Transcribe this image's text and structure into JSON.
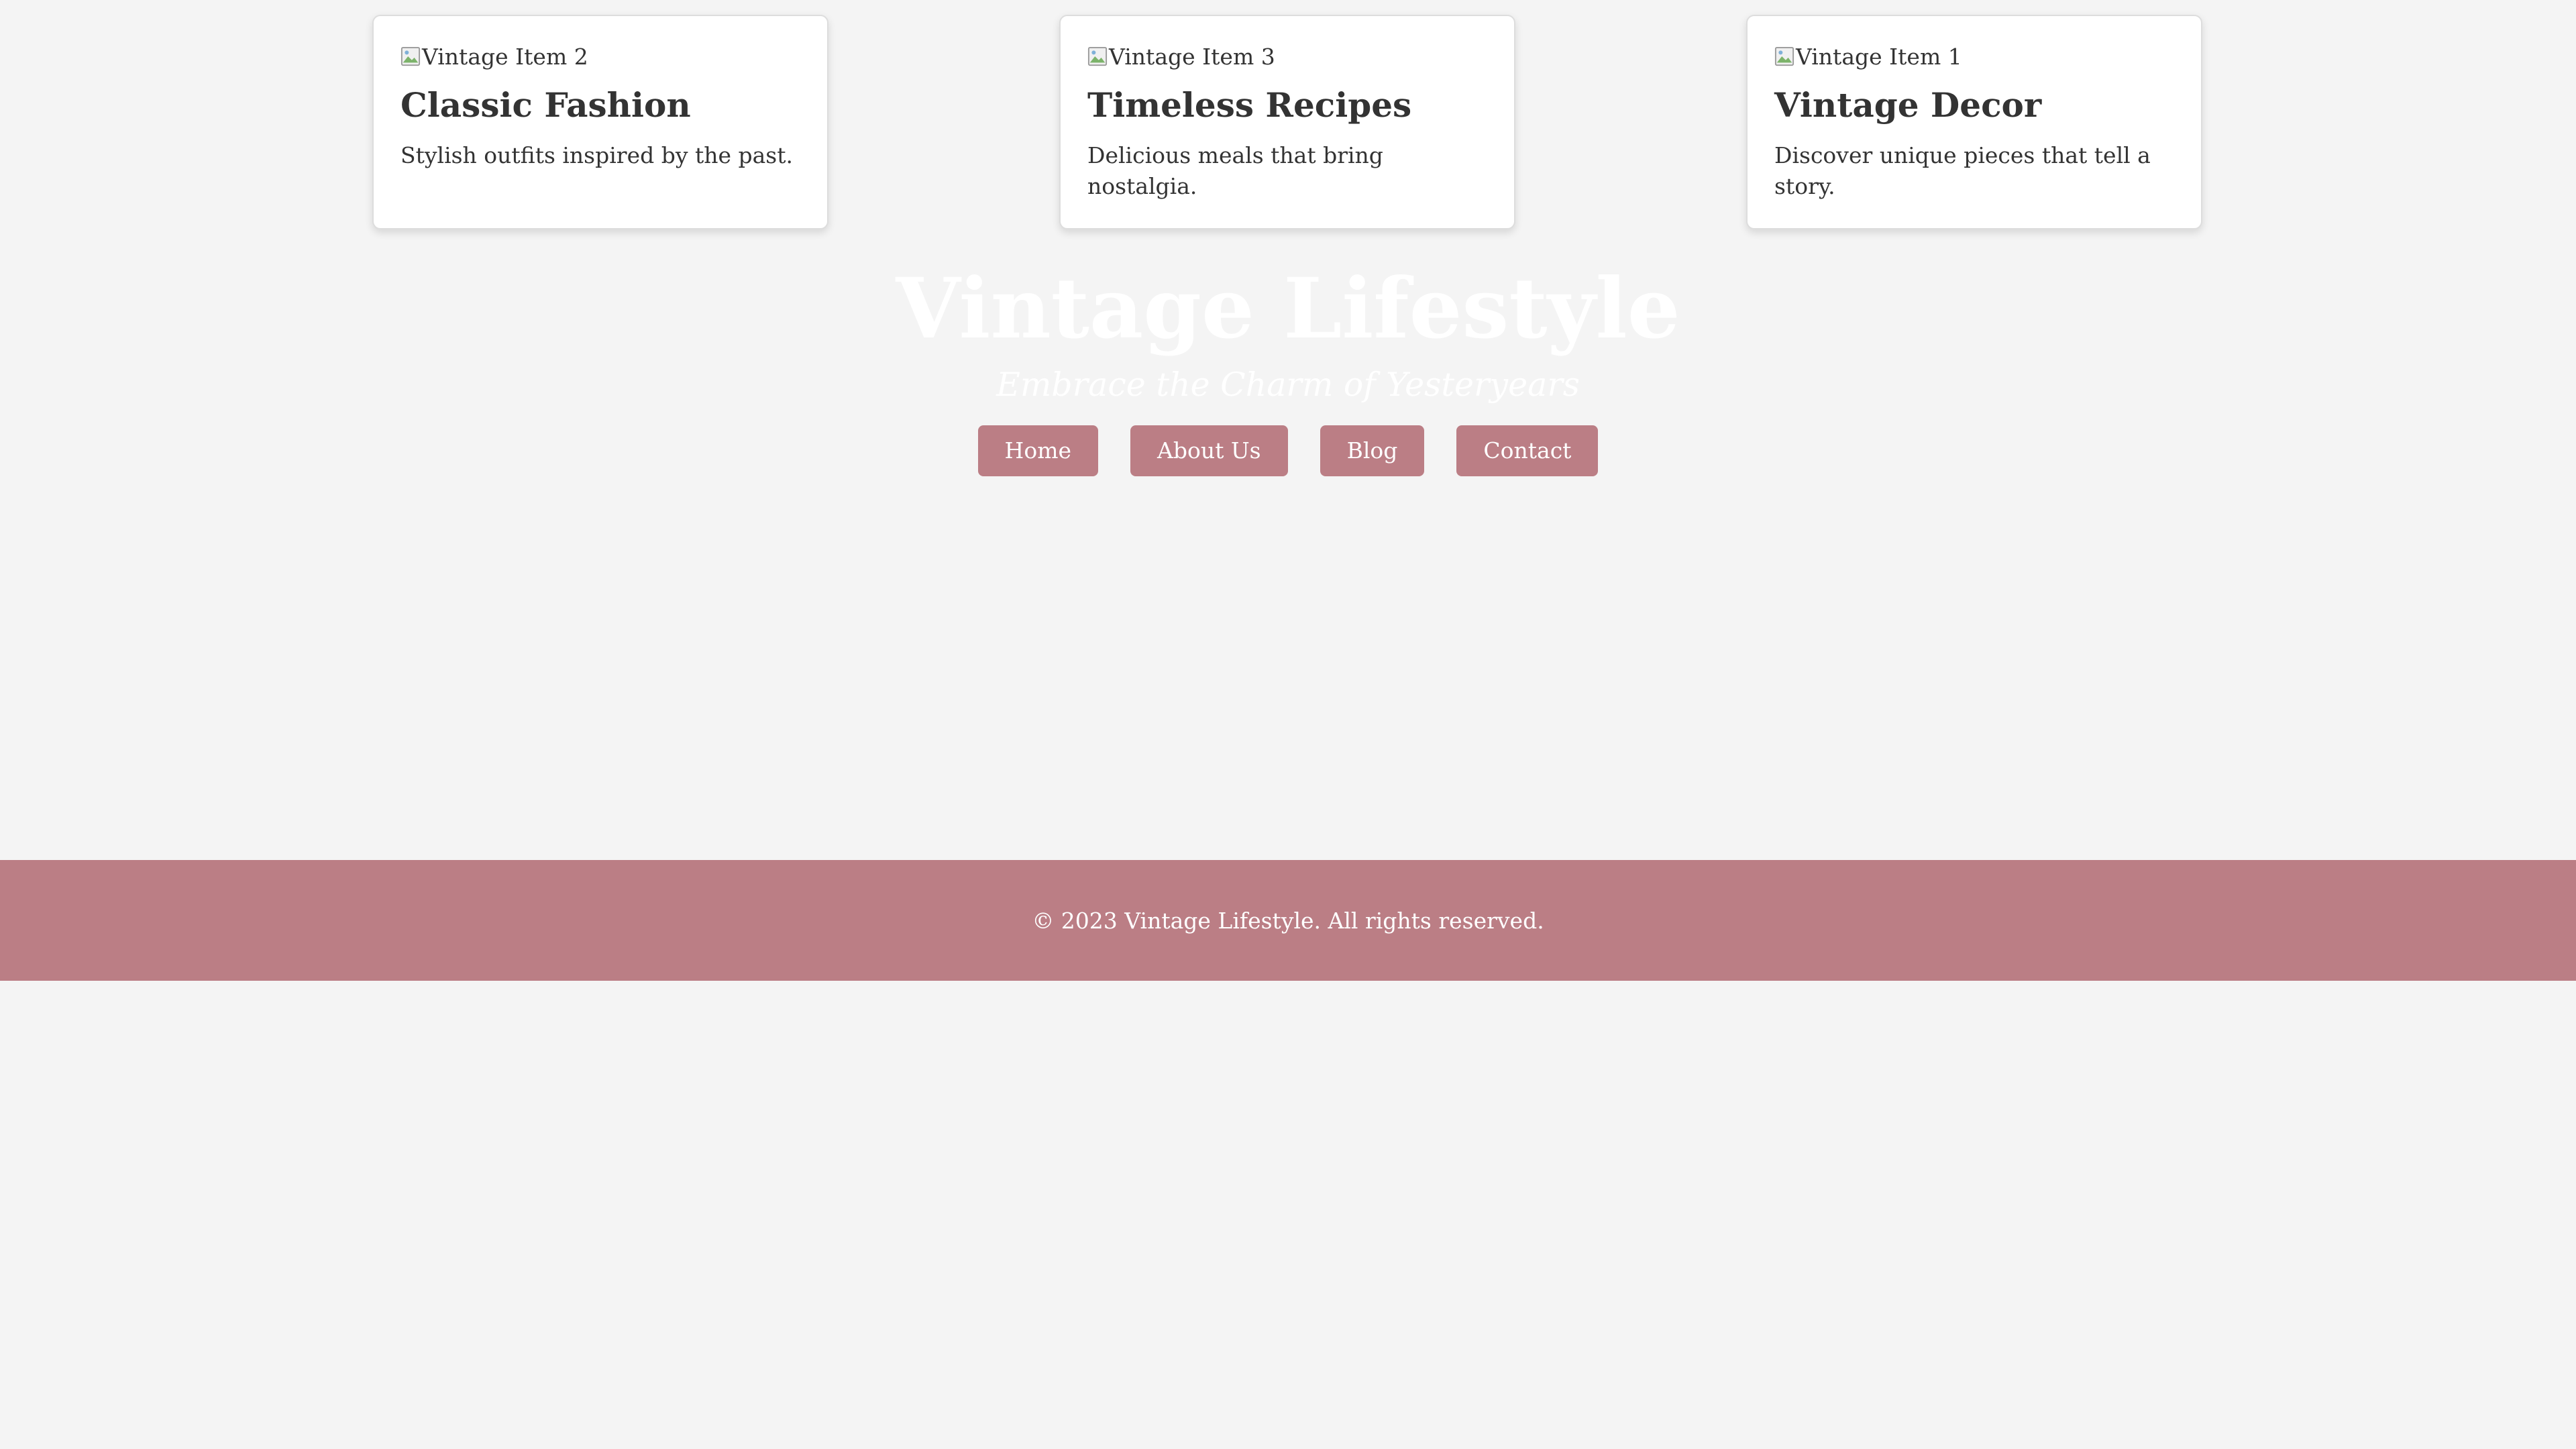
{
  "cards": [
    {
      "image_alt": "Vintage Item 2",
      "title": "Classic Fashion",
      "description": "Stylish outfits inspired by the past."
    },
    {
      "image_alt": "Vintage Item 3",
      "title": "Timeless Recipes",
      "description": "Delicious meals that bring nostalgia."
    },
    {
      "image_alt": "Vintage Item 1",
      "title": "Vintage Decor",
      "description": "Discover unique pieces that tell a story."
    }
  ],
  "header": {
    "title": "Vintage Lifestyle",
    "tagline": "Embrace the Charm of Yesteryears"
  },
  "nav": {
    "items": [
      {
        "label": "Home"
      },
      {
        "label": "About Us"
      },
      {
        "label": "Blog"
      },
      {
        "label": "Contact"
      }
    ]
  },
  "footer": {
    "text": "© 2023 Vintage Lifestyle. All rights reserved."
  },
  "colors": {
    "accent": "#bb7e85",
    "background": "#f4f4f4",
    "card_background": "#ffffff",
    "text": "#333333"
  },
  "icons": {
    "card_image": "broken-image-icon"
  }
}
